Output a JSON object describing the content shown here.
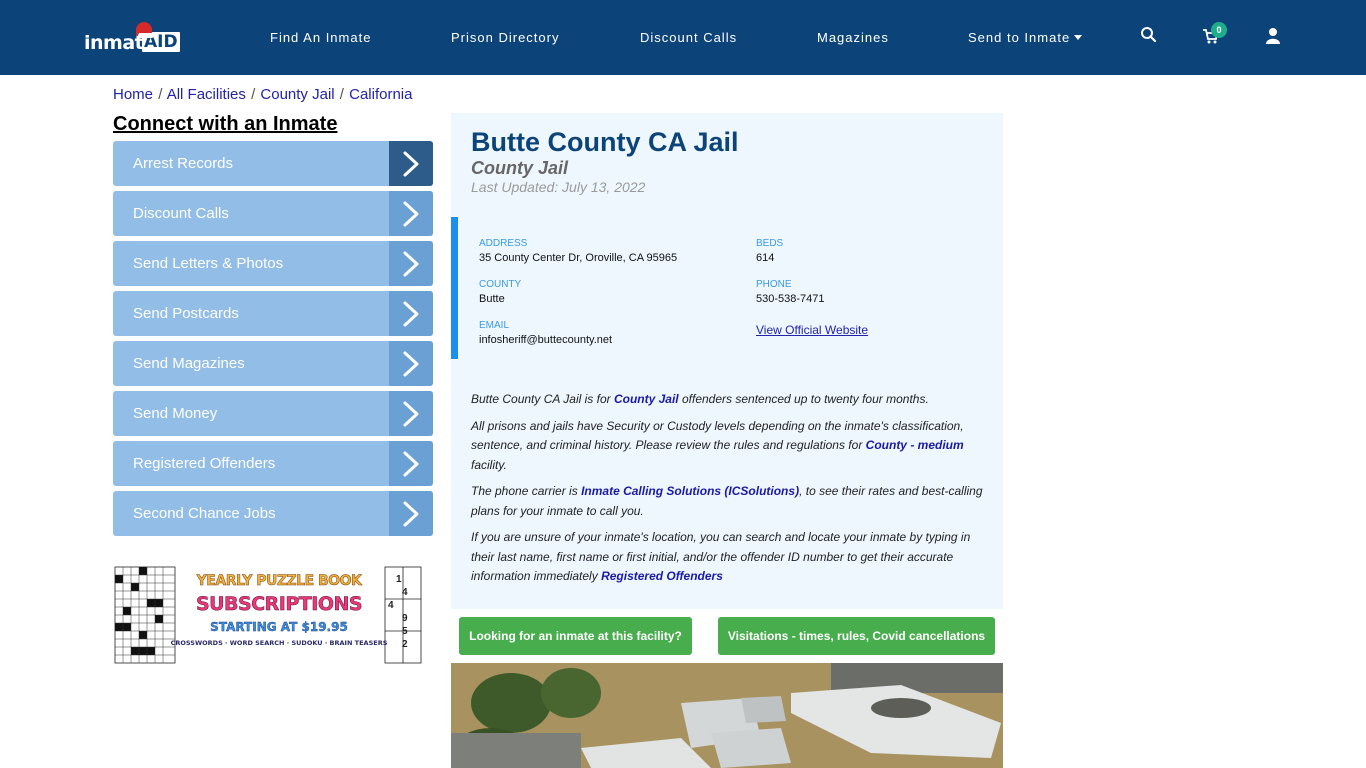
{
  "header": {
    "logo_text": "inmate",
    "logo_badge": "AID",
    "nav": [
      {
        "label": "Find An Inmate"
      },
      {
        "label": "Prison Directory"
      },
      {
        "label": "Discount Calls"
      },
      {
        "label": "Magazines"
      },
      {
        "label": "Send to Inmate"
      }
    ],
    "cart_count": "0",
    "icons": {
      "search": "search-icon",
      "cart": "cart-icon",
      "user": "user-icon"
    }
  },
  "breadcrumb": [
    {
      "label": "Home"
    },
    {
      "label": "All Facilities"
    },
    {
      "label": "County Jail"
    },
    {
      "label": "California"
    }
  ],
  "breadcrumb_sep": "/",
  "sidebar": {
    "title": "Connect with an Inmate",
    "items": [
      {
        "label": "Arrest Records"
      },
      {
        "label": "Discount Calls"
      },
      {
        "label": "Send Letters & Photos"
      },
      {
        "label": "Send Postcards"
      },
      {
        "label": "Send Magazines"
      },
      {
        "label": "Send Money"
      },
      {
        "label": "Registered Offenders"
      },
      {
        "label": "Second Chance Jobs"
      }
    ],
    "ad": {
      "line1": "YEARLY PUZZLE BOOK",
      "line2": "SUBSCRIPTIONS",
      "line3": "STARTING AT $19.95",
      "line4": "CROSSWORDS · WORD SEARCH · SUDOKU · BRAIN TEASERS",
      "sudoku_digits": [
        "1",
        "4",
        "4",
        "9",
        "5",
        "2"
      ]
    }
  },
  "facility": {
    "name": "Butte County CA Jail",
    "type": "County Jail",
    "last_updated": "Last Updated: July 13, 2022",
    "fields": {
      "address_label": "ADDRESS",
      "address": "35 County Center Dr, Oroville, CA 95965",
      "beds_label": "BEDS",
      "beds": "614",
      "county_label": "COUNTY",
      "county": "Butte",
      "phone_label": "PHONE",
      "phone": "530-538-7471",
      "email_label": "EMAIL",
      "email": "infosheriff@buttecounty.net",
      "website_link": "View Official Website"
    },
    "description": {
      "p1_a": "Butte County CA Jail is for ",
      "p1_link": "County Jail",
      "p1_b": " offenders sentenced up to twenty four months.",
      "p2_a": "All prisons and jails have Security or Custody levels depending on the inmate's classification, sentence, and criminal history. Please review the rules and regulations for ",
      "p2_link": "County - medium",
      "p2_b": " facility.",
      "p3_a": "The phone carrier is ",
      "p3_link": "Inmate Calling Solutions (ICSolutions)",
      "p3_b": ", to see their rates and best-calling plans for your inmate to call you.",
      "p4_a": "If you are unsure of your inmate's location, you can search and locate your inmate by typing in their last name, first name or first initial, and/or the offender ID number to get their accurate information immediately ",
      "p4_link": "Registered Offenders"
    }
  },
  "buttons": {
    "find_inmate": "Looking for an inmate at this facility?",
    "visitations": "Visitations - times, rules, Covid cancellations"
  },
  "colors": {
    "nav_bg": "#0c4479",
    "accent_blue": "#1b8ef0",
    "sidebar_item": "#92bde6",
    "green_button": "#48ae4d",
    "cart_badge": "#1fae8c"
  }
}
